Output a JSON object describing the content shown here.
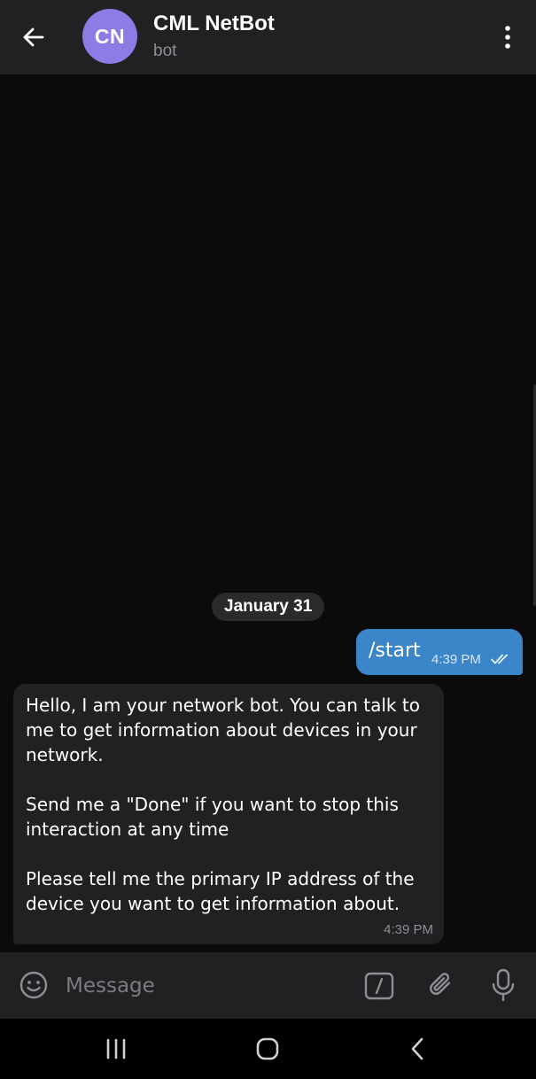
{
  "header": {
    "back_icon": "arrow-left-icon",
    "avatar_initials": "CN",
    "avatar_color": "#8e7ce6",
    "title": "CML NetBot",
    "subtitle": "bot",
    "menu_icon": "more-vertical-icon"
  },
  "chat": {
    "date_separator": "January 31",
    "messages": [
      {
        "direction": "outgoing",
        "text": "/start",
        "time": "4:39 PM",
        "status": "read",
        "status_icon": "double-check-icon",
        "bubble_color": "#3b86c9"
      },
      {
        "direction": "incoming",
        "paragraphs": [
          "Hello, I am your network bot. You can talk to me to get information about devices in your network.",
          "Send me a \"Done\" if you want to stop this interaction at any time",
          "Please tell me the primary IP address of the device you want to get information about."
        ],
        "time": "4:39 PM",
        "bubble_color": "#212123"
      }
    ]
  },
  "composer": {
    "emoji_icon": "emoji-icon",
    "placeholder": "Message",
    "value": "",
    "commands_icon": "bot-commands-icon",
    "attach_icon": "paperclip-icon",
    "mic_icon": "microphone-icon"
  },
  "system_nav": {
    "recents_icon": "recents-icon",
    "home_icon": "home-icon",
    "back_icon": "back-chevron-icon"
  }
}
